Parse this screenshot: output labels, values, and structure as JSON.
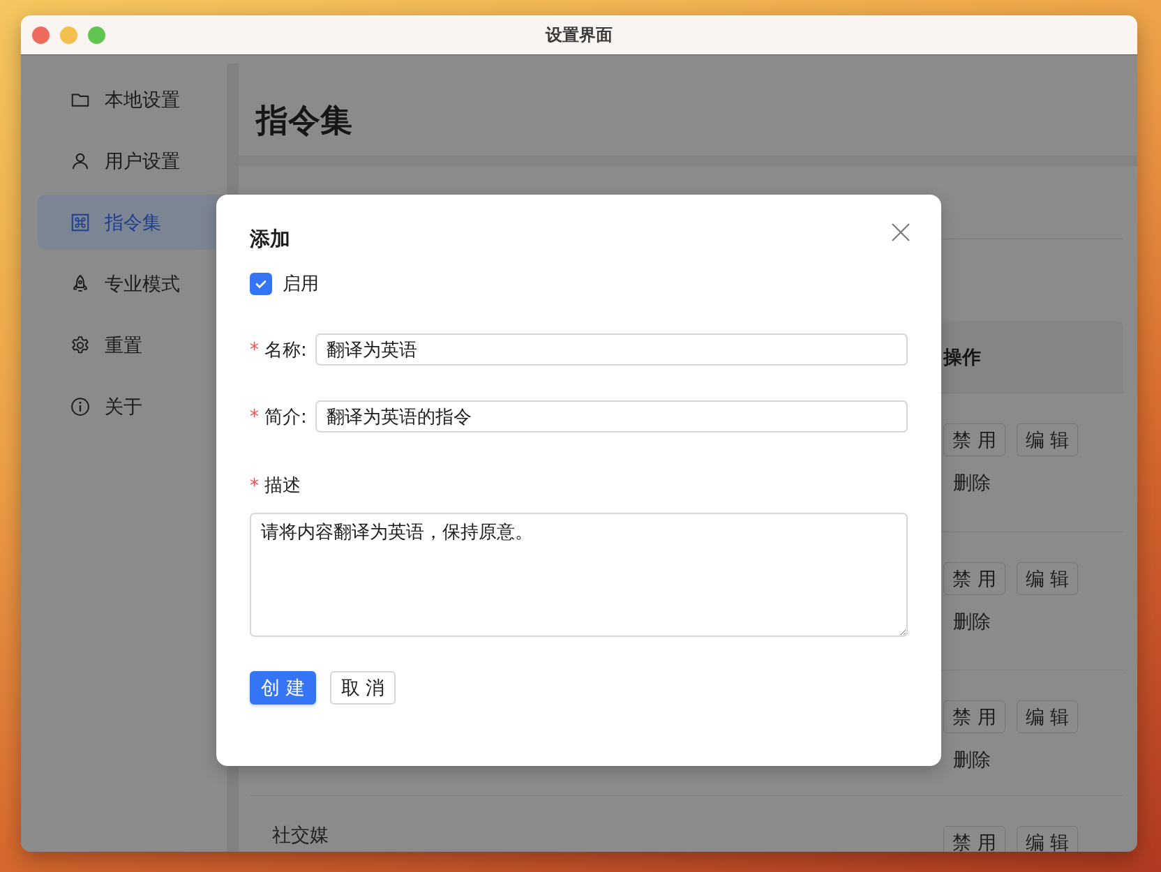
{
  "window": {
    "title": "设置界面"
  },
  "sidebar": {
    "items": [
      {
        "label": "本地设置",
        "selected": false
      },
      {
        "label": "用户设置",
        "selected": false
      },
      {
        "label": "指令集",
        "selected": true
      },
      {
        "label": "专业模式",
        "selected": false
      },
      {
        "label": "重置",
        "selected": false
      },
      {
        "label": "关于",
        "selected": false
      }
    ]
  },
  "page": {
    "heading": "指令集"
  },
  "table": {
    "columns": [
      "操作"
    ],
    "rows": [
      {
        "actions": [
          {
            "label": "禁 用",
            "kind": "button"
          },
          {
            "label": "编 辑",
            "kind": "button"
          },
          {
            "label": "删除",
            "kind": "link"
          }
        ]
      },
      {
        "actions": [
          {
            "label": "禁 用",
            "kind": "button"
          },
          {
            "label": "编 辑",
            "kind": "button"
          },
          {
            "label": "删除",
            "kind": "link"
          }
        ]
      },
      {
        "actions": [
          {
            "label": "禁 用",
            "kind": "button"
          },
          {
            "label": "编 辑",
            "kind": "button"
          },
          {
            "label": "删除",
            "kind": "link"
          }
        ]
      },
      {
        "name": "社交媒",
        "actions": [
          {
            "label": "禁 用",
            "kind": "button"
          },
          {
            "label": "编 辑",
            "kind": "button"
          }
        ]
      }
    ]
  },
  "dialog": {
    "title": "添加",
    "enable": {
      "label": "启用",
      "checked": true
    },
    "fields": [
      {
        "kind": "input",
        "required_mark": "*",
        "label": "名称:",
        "value": "翻译为英语"
      },
      {
        "kind": "input",
        "required_mark": "*",
        "label": "简介:",
        "value": "翻译为英语的指令"
      },
      {
        "kind": "textarea",
        "required_mark": "*",
        "label": "描述",
        "value": "请将内容翻译为英语，保持原意。"
      }
    ],
    "buttons": [
      {
        "label": "创 建",
        "kind": "primary"
      },
      {
        "label": "取 消",
        "kind": "default"
      }
    ]
  }
}
